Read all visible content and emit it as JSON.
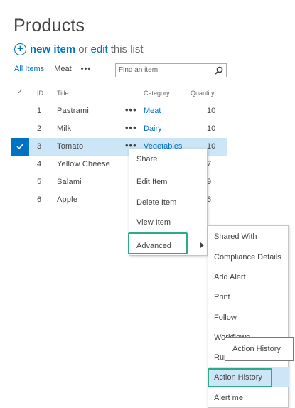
{
  "page": {
    "title": "Products",
    "new_item": "new item",
    "or": "or",
    "edit": "edit",
    "this_list": "this list"
  },
  "views": {
    "all_items": "All Items",
    "meat": "Meat",
    "more": "•••"
  },
  "search": {
    "placeholder": "Find an item"
  },
  "columns": {
    "check": "✓",
    "id": "ID",
    "title": "Title",
    "category": "Category",
    "quantity": "Quantity"
  },
  "rows": [
    {
      "id": "1",
      "title": "Pastrami",
      "category": "Meat",
      "quantity": "10",
      "selected": false
    },
    {
      "id": "2",
      "title": "Milk",
      "category": "Dairy",
      "quantity": "10",
      "selected": false
    },
    {
      "id": "3",
      "title": "Tomato",
      "category": "Vegetables",
      "quantity": "10",
      "selected": true
    },
    {
      "id": "4",
      "title": "Yellow Cheese",
      "category": "",
      "quantity": "7",
      "selected": false
    },
    {
      "id": "5",
      "title": "Salami",
      "category": "",
      "quantity": "9",
      "selected": false
    },
    {
      "id": "6",
      "title": "Apple",
      "category": "",
      "quantity": "6",
      "selected": false
    }
  ],
  "ellipsis": "•••",
  "context_menu": {
    "items": [
      "Share",
      "Edit Item",
      "Delete Item",
      "View Item",
      "Advanced"
    ]
  },
  "advanced_menu": {
    "items": [
      "Shared With",
      "Compliance Details",
      "Add Alert",
      "Print",
      "Follow",
      "Workflows",
      "Run",
      "Action History",
      "Alert me"
    ]
  },
  "tooltip": {
    "text": "Action History"
  },
  "colors": {
    "accent": "#0072c6",
    "selected_row": "#cde6f7",
    "highlight_box": "#2bab88"
  }
}
